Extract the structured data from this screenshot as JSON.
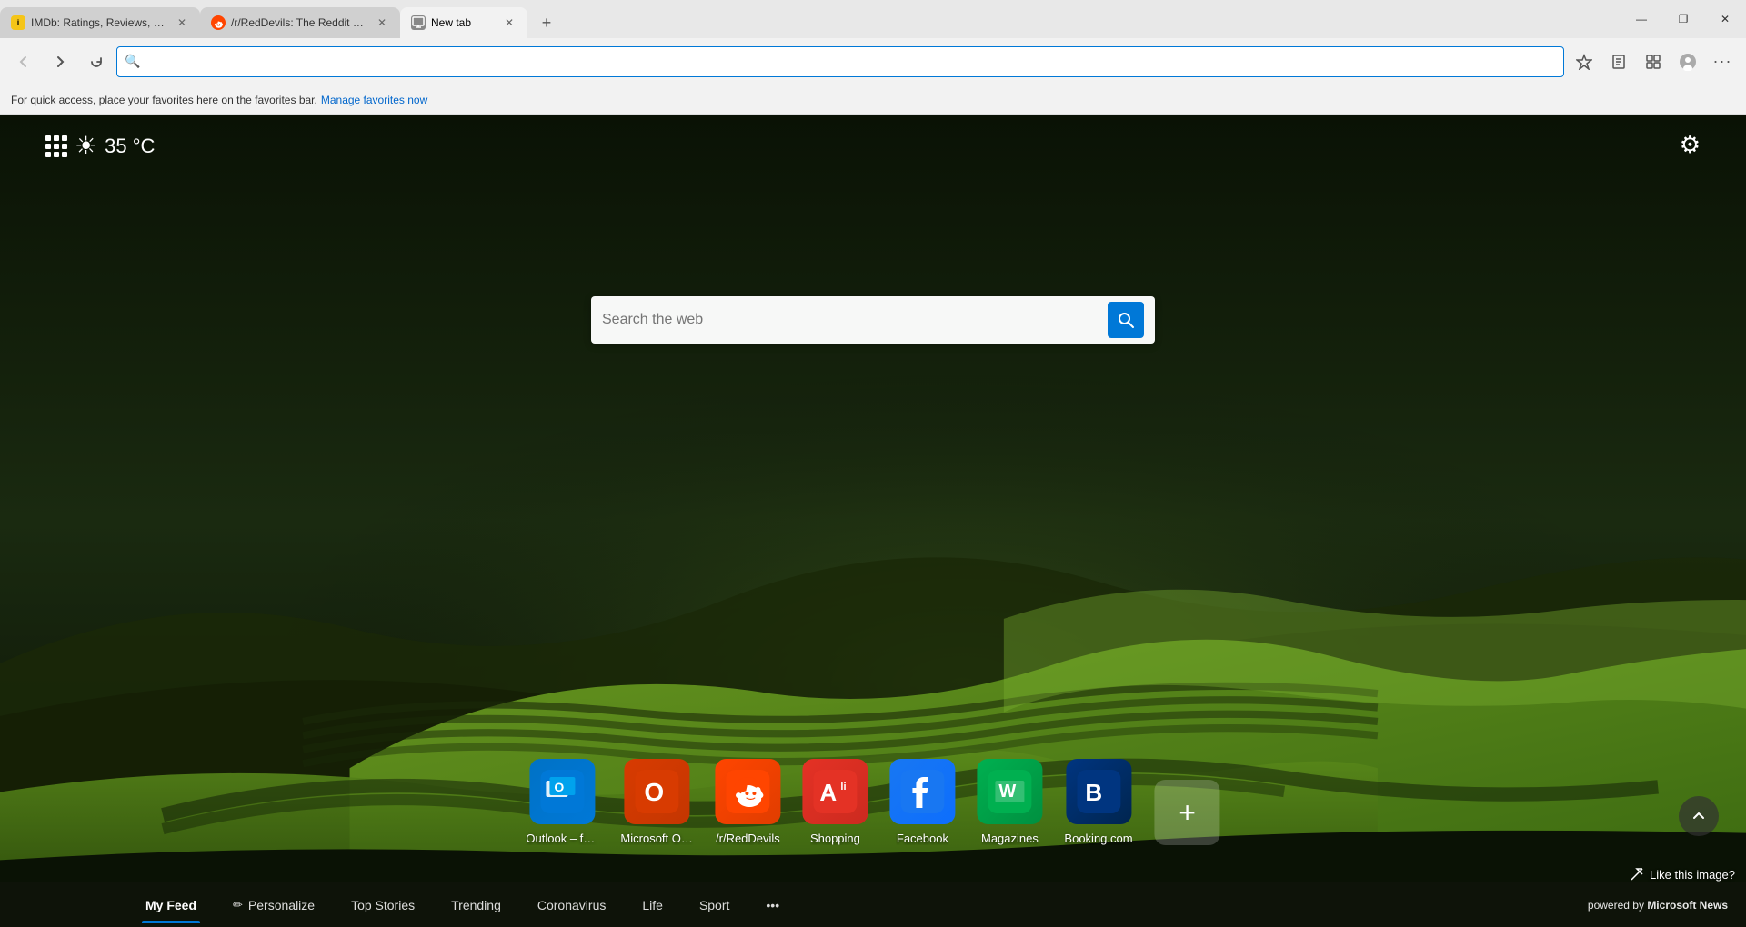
{
  "tabs": [
    {
      "id": "imdb",
      "title": "IMDb: Ratings, Reviews, and Wh...",
      "favicon_color": "#f5c518",
      "favicon_text": "IMDb",
      "active": false
    },
    {
      "id": "reddit",
      "title": "/r/RedDevils: The Reddit home f...",
      "favicon_color": "#ff4500",
      "favicon_symbol": "👽",
      "active": false
    },
    {
      "id": "newtab",
      "title": "New tab",
      "favicon_symbol": "⬜",
      "active": true
    }
  ],
  "window_controls": {
    "minimize": "—",
    "restore": "❐",
    "close": "✕"
  },
  "address_bar": {
    "placeholder": "",
    "value": "",
    "search_icon": "🔍"
  },
  "favorites_bar": {
    "text": "For quick access, place your favorites here on the favorites bar.",
    "link_text": "Manage favorites now"
  },
  "weather": {
    "temperature": "35 °C"
  },
  "search": {
    "placeholder": "Search the web"
  },
  "shortcuts": [
    {
      "id": "outlook",
      "label": "Outlook – fre...",
      "icon_class": "icon-outlook",
      "icon_text": "O"
    },
    {
      "id": "office",
      "label": "Microsoft Offi...",
      "icon_class": "icon-office",
      "icon_text": "O"
    },
    {
      "id": "reddit",
      "label": "/r/RedDevils",
      "icon_class": "icon-reddit",
      "icon_text": "👽"
    },
    {
      "id": "shopping",
      "label": "Shopping",
      "icon_class": "icon-aliexpress",
      "icon_text": "A"
    },
    {
      "id": "facebook",
      "label": "Facebook",
      "icon_class": "icon-facebook",
      "icon_text": "f"
    },
    {
      "id": "magazines",
      "label": "Magazines",
      "icon_class": "icon-magazines",
      "icon_text": "W"
    },
    {
      "id": "booking",
      "label": "Booking.com",
      "icon_class": "icon-booking",
      "icon_text": "B"
    }
  ],
  "add_shortcut_label": "+",
  "scroll_up": "⌃",
  "like_image": {
    "icon": "↗",
    "label": "Like this image?"
  },
  "bottom_nav": {
    "items": [
      {
        "id": "myfeed",
        "label": "My Feed",
        "active": true
      },
      {
        "id": "personalize",
        "label": "Personalize",
        "has_icon": true,
        "icon": "✏"
      },
      {
        "id": "topstories",
        "label": "Top Stories",
        "active": false
      },
      {
        "id": "trending",
        "label": "Trending",
        "active": false
      },
      {
        "id": "coronavirus",
        "label": "Coronavirus",
        "active": false
      },
      {
        "id": "life",
        "label": "Life",
        "active": false
      },
      {
        "id": "sport",
        "label": "Sport",
        "active": false
      },
      {
        "id": "more",
        "label": "•••",
        "active": false
      }
    ],
    "powered_by_text": "powered by",
    "powered_by_brand": "Microsoft News"
  }
}
